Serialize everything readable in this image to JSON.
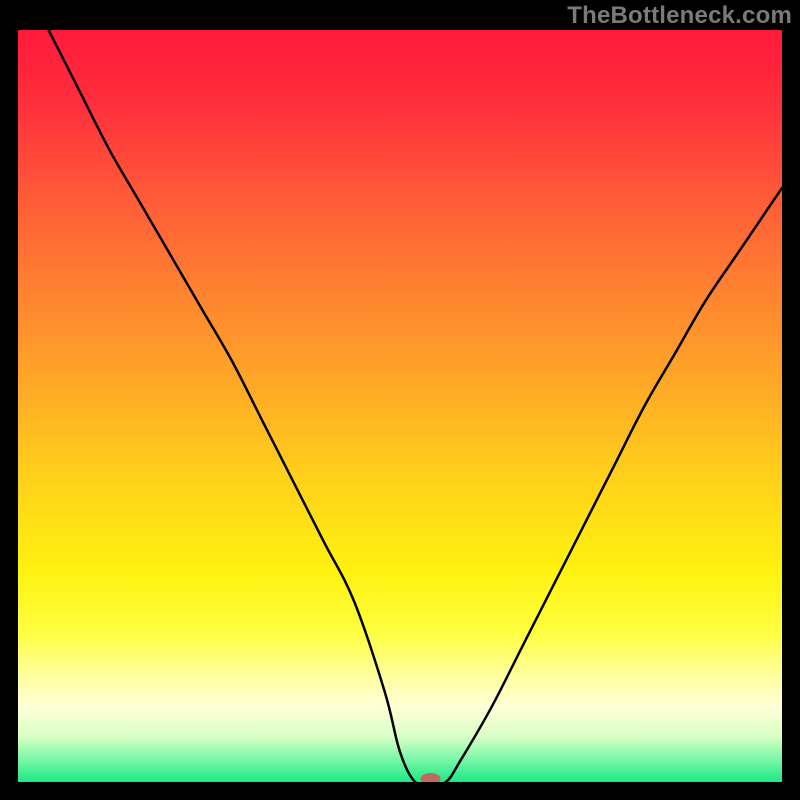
{
  "watermark": "TheBottleneck.com",
  "chart_data": {
    "type": "line",
    "title": "",
    "xlabel": "",
    "ylabel": "",
    "xlim": [
      0,
      100
    ],
    "ylim": [
      0,
      100
    ],
    "grid": false,
    "legend": false,
    "background": {
      "type": "vertical-gradient",
      "stops": [
        {
          "pos": 0.0,
          "color": "#ff1a3a"
        },
        {
          "pos": 0.1,
          "color": "#ff2f3d"
        },
        {
          "pos": 0.22,
          "color": "#ff5a38"
        },
        {
          "pos": 0.35,
          "color": "#ff8330"
        },
        {
          "pos": 0.48,
          "color": "#ffab26"
        },
        {
          "pos": 0.6,
          "color": "#ffd21a"
        },
        {
          "pos": 0.72,
          "color": "#fff210"
        },
        {
          "pos": 0.8,
          "color": "#ffff40"
        },
        {
          "pos": 0.86,
          "color": "#ffffa0"
        },
        {
          "pos": 0.9,
          "color": "#ffffd8"
        },
        {
          "pos": 0.94,
          "color": "#d8ffc4"
        },
        {
          "pos": 0.97,
          "color": "#78f7a8"
        },
        {
          "pos": 1.0,
          "color": "#1de884"
        }
      ]
    },
    "series": [
      {
        "name": "bottleneck-curve",
        "color": "#000000",
        "stroke_width": 2.5,
        "x": [
          4,
          8,
          12,
          16,
          20,
          24,
          28,
          32,
          36,
          40,
          44,
          48,
          50,
          52,
          54,
          56,
          58,
          62,
          66,
          70,
          74,
          78,
          82,
          86,
          90,
          94,
          98,
          100
        ],
        "y": [
          100,
          92,
          84,
          77,
          70,
          63,
          56,
          48,
          40,
          32,
          24,
          12,
          4,
          0,
          0,
          0,
          3,
          10,
          18,
          26,
          34,
          42,
          50,
          57,
          64,
          70,
          76,
          79
        ]
      }
    ],
    "marker": {
      "name": "optimum-marker",
      "x": 54,
      "y": 0,
      "color": "#c06a5f",
      "rx": 10,
      "ry": 6
    }
  }
}
